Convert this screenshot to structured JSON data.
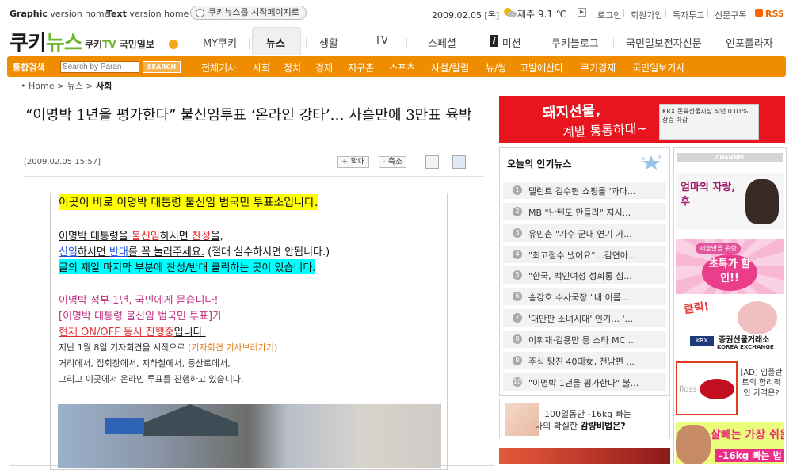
{
  "util": {
    "graphic_prefix": "Graphic",
    "graphic_suffix": " version home",
    "text_prefix": "Text",
    "text_suffix": " version home",
    "set_start": "쿠키뉴스를 시작페이지로",
    "date": "2009.02.05 [목]",
    "weather": "제주 9.1 ℃",
    "play": "▶",
    "links": [
      "로그인",
      "회원가입",
      "독자투고",
      "신문구독"
    ],
    "rss": "RSS"
  },
  "logo": {
    "main_a": "쿠키",
    "main_b": "뉴스",
    "partner_tv_a": "쿠키",
    "partner_tv_b": "TV",
    "partner_paper": "국민일보"
  },
  "gnb": {
    "items": [
      "MY쿠키",
      "뉴스",
      "생활",
      "TV",
      "스페셜",
      "-미션",
      "쿠키블로그",
      "국민일보전자신문",
      "인포플라자"
    ],
    "i_letter": "i"
  },
  "searchbar": {
    "label": "통합검색",
    "placeholder": "Search by Paran",
    "button": "SEARCH"
  },
  "subnav": [
    "전체기사",
    "사회",
    "정치",
    "경제",
    "지구촌",
    "스포츠",
    "사설/칼럼",
    "뉴/씽",
    "고발에산다",
    "쿠키경제",
    "국민일보기사"
  ],
  "breadcrumb": {
    "home": "Home",
    "sep": ">",
    "news": "뉴스",
    "current": "사회",
    "bullet": "•"
  },
  "article": {
    "headline": "“이명박 1년을 평가한다” 불신임투표 ‘온라인 강타’… 사흘만에 3만표 육박",
    "date": "[2009.02.05 15:57]",
    "zoom_in": "+ 확대",
    "zoom_out": "- 축소",
    "body": {
      "l1": "이곳이 바로 이명박 대통령 불신임 범국민 투표소입니다.",
      "l2a": "이명박 대통령을 ",
      "l2b": "불신임",
      "l2c": "하시면 ",
      "l2d": "찬성",
      "l2e": "을,",
      "l3a": "신임",
      "l3b": "하시면 ",
      "l3c": "반대",
      "l3d": "를 꼭 눌러주세요.",
      "l3e": " (절대 실수하시면 안됩니다.)",
      "l4": "글의 제일 마지막 부분에 찬성/반대 클릭하는 곳이 있습니다.",
      "l5": "이명박 정부 1년, 국민에게 묻습니다!",
      "l6a": "[이명박 대통령 불신임 범국민 투표]",
      "l6b": "가",
      "l7a": "현재 ON/OFF 동시 진행중",
      "l7b": "입니다.",
      "s1a": "지난 1월 8일 기자회견을 시작으로 ",
      "s1b": "(기자회견 기사보러가기)",
      "s2": "거리에서, 집회장에서, 지하철에서, 등산로에서,",
      "s3": "그리고 이곳에서 온라인 투표를 진행하고 있습니다."
    }
  },
  "banner_top": {
    "text1": "돼지선물,",
    "text2": "계발 통통하대~",
    "paper": "KRX 돈육선물시장 작년 0.01% 상승 마감"
  },
  "hot_news": {
    "title": "오늘의 인기뉴스",
    "items": [
      {
        "num": "1",
        "text": "탤런트 김수현 쇼핑몰 '과다..."
      },
      {
        "num": "2",
        "text": "MB \"난텐도 만들라\" 지시..."
      },
      {
        "num": "3",
        "text": "유인촌 \"가수 군대 연기 가..."
      },
      {
        "num": "4",
        "text": "\"최고점수 냈어요\"…김연아..."
      },
      {
        "num": "5",
        "text": "\"한국, 백인여성 성희롱 심..."
      },
      {
        "num": "6",
        "text": "송강호 수사국장 \"내 이름..."
      },
      {
        "num": "7",
        "text": "'대만판 소녀시대' 인기… '..."
      },
      {
        "num": "8",
        "text": "이휘재·김용만 등 스타 MC ..."
      },
      {
        "num": "9",
        "text": "주식 탕진 40대女, 전남편 ..."
      },
      {
        "num": "10",
        "text": "\"이명박 1년을 평가한다\" 불..."
      }
    ]
  },
  "diet_ad": {
    "line1": "100일동안 -16kg 빠는",
    "line2a": "나의 확실한 ",
    "line2b": "감량비법은?"
  },
  "channel": {
    "title": "CHANNEL",
    "ad1": "엄마의 자랑, 후",
    "ad2_top": "새출발을 위한",
    "ad2_main": "초특가 할인!!",
    "ad3_click": "클릭!",
    "ad3_krx": "KRX",
    "ad3_name": "증권선물거래소",
    "ad3_en": "KOREA EXCHANGE",
    "ad4_floss": "floss",
    "ad4_text": "[AD] 임플란트의 합리적인 가격은?",
    "ad5_top": "살빼는 가장 쉬운 법!",
    "ad5_bottom": "-16kg 빠는 법"
  },
  "colors": {
    "orange": "#f08c00",
    "green": "#6cb52d",
    "red": "#e8151f"
  }
}
